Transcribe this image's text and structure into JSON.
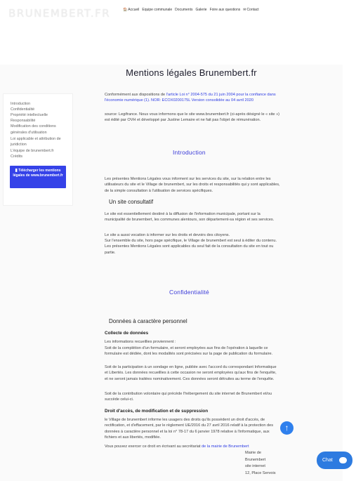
{
  "header": {
    "brand": "BRUNEMBERT.FR",
    "nav": [
      {
        "label": "Accueil",
        "icon": "home-icon"
      },
      {
        "label": "Equipe communale"
      },
      {
        "label": "Documents"
      },
      {
        "label": "Galerie"
      },
      {
        "label": "Foire aux questions"
      },
      {
        "label": "Contact",
        "icon": "contact-icon"
      }
    ]
  },
  "page": {
    "title": "Mentions légales Brunembert.fr"
  },
  "sidebar": {
    "items": [
      "Introduction",
      "Confidentialité",
      "Propriété intellectuelle",
      "Responsabilité",
      "Modification des conditions générales d'utilisation",
      "Loi applicable et attribution de juridiction",
      "L'équipe de brunembert.fr",
      "Crédits"
    ],
    "download_button": "Télécharger les mentions légales de www.brunembert.fr"
  },
  "intro_block": {
    "line1_prefix": "Conformément aux dispositions de ",
    "line1_link": "l'article Loi n° 2004-575 du 21 juin 2004 pour la confiance dans l'économie numérique (1). NOR: ECOX0200175L Version consolidée au 04 avril 2020",
    "line2": "source: Legifrance. Nous vous informons que le site www.brunembert.fr (ci-après désigné le « site ») est édité par OVH et développé par Justine Lemaire et ne fait pas l'objet de rémunération."
  },
  "sections": {
    "introduction": {
      "heading": "Introduction",
      "text": "Les présentes Mentions Légales vous informent sur les services du site, sur la relation entre les utilisateurs du site et le Village de brunembert, sur les droits et responsabilités qui y sont applicables, de la simple consultation à l'utilisation de services spécifiques."
    },
    "consultatif": {
      "heading": "Un site consultatif",
      "p1": "Le site est essentiellement destiné à la diffusion de l'information municipale, portant sur la municipalité de brunembert, les communes alentours, son département-sa région et ses services.",
      "p2": "Le site a aussi vocation à informer sur les droits et devoirs des citoyens.",
      "p3": "Sur l'ensemble du site, hors page spécifique, le Village de brunembert est seul à éditer du contenu. Les présentes Mentions Légales sont applicables du seul fait de la consultation du site en tout ou partie."
    },
    "confidentialite": {
      "heading": "Confidentialité"
    },
    "donnees": {
      "heading": "Données à caractère personnel",
      "collecte_heading": "Collecte de données",
      "collecte_lines": [
        "Les informations recueillies proviennent :",
        "Soit de la complétion d'un formulaire, et seront employées aux fins de l'opération à laquelle ce formulaire est dédiée, dont les modalités sont précisées sur la page de publication du formulaire.",
        "Soit de la participation à un sondage en ligne, publiée avec l'accord du correspondant Informatique et Libertés. Les données recueillies à cette occasion ne seront employées qu'aux fins de l'enquête, et ne seront jamais traitées nominativement. Ces données seront détruites au terme de l'enquête.",
        "Soit de la contribution volontaire qui précède l'hébergement du site internet de Brunembert et/ou succède celui-ci."
      ],
      "droit_heading": "Droit d'accès, de modification et de suppression",
      "droit_text": "le Village de brunembert informe les usagers des droits qu'ils possèdent un droit d'accès, de rectification, et d'effacement, par le règlement UE/2016 du 27 avril 2016 relatif à la protection des données à caractère personnel et la loi n° 78-17 du 6 janvier 1978 relative à l'informatique, aux fichiers et aux libertés, modifiée.",
      "droit_line2_prefix": "Vous pouvez exercer ce droit en écrivant au secrétariat ",
      "droit_line2_link": "de la mairie de Brunembert"
    }
  },
  "address": {
    "lines": [
      "Mairie de",
      "Brunembert",
      "site internet",
      "12, Place Servois"
    ]
  },
  "widgets": {
    "scroll_top": "↑",
    "chat_label": "Chat"
  },
  "colors": {
    "accent": "#3542e8",
    "link": "#2e3de3",
    "heading": "#3b3bd8",
    "chat": "#2d7be0"
  }
}
